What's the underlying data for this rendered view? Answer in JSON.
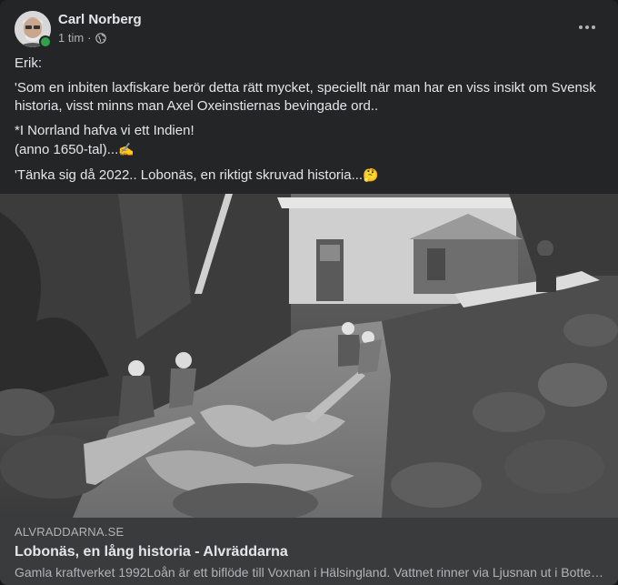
{
  "post": {
    "author": "Carl Norberg",
    "time": "1 tim",
    "separator": "·",
    "privacy_icon": "globe-icon",
    "more_icon": "more-options-icon",
    "online_color": "#31a24c",
    "paragraphs": [
      "Erik:",
      "'Som en inbiten laxfiskare berör detta rätt mycket, speciellt när man har en viss insikt om Svensk historia, visst minns man Axel Oxeinstiernas bevingade ord..",
      "*I Norrland hafva vi ett Indien!",
      "(anno 1650-tal)...",
      "'Tänka sig då 2022.. Lobonäs, en riktigt skruvad historia..."
    ],
    "emoji_1": "✍",
    "emoji_2": "🤔"
  },
  "link": {
    "domain": "ALVRADDARNA.SE",
    "title": "Lobonäs, en lång historia - Alvräddarna",
    "description": "Gamla kraftverket 1992Loån är ett biflöde till Voxnan i Hälsingland. Vattnet rinner via Ljusnan ut i Bottenhavet. Loån är ett biflöde till Voxnan"
  }
}
